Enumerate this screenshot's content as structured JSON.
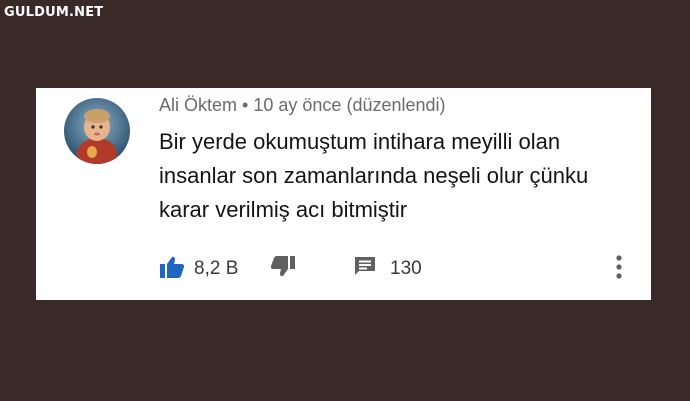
{
  "watermark": "GULDUM.NET",
  "comment": {
    "author": "Ali Öktem",
    "separator": "•",
    "time": "10 ay önce",
    "edited": "(düzenlendi)",
    "text": "Bir yerde okumuştum intihara meyilli olan insanlar son zamanlarında neşeli olur çünku karar verilmiş acı bitmiştir"
  },
  "actions": {
    "likes": "8,2 B",
    "replies": "130"
  },
  "colors": {
    "background": "#3a2a27",
    "like_active": "#1f66c2",
    "icon_gray": "#606060"
  },
  "icons": [
    "thumbs-up-icon",
    "thumbs-down-icon",
    "comment-icon",
    "more-vert-icon"
  ]
}
